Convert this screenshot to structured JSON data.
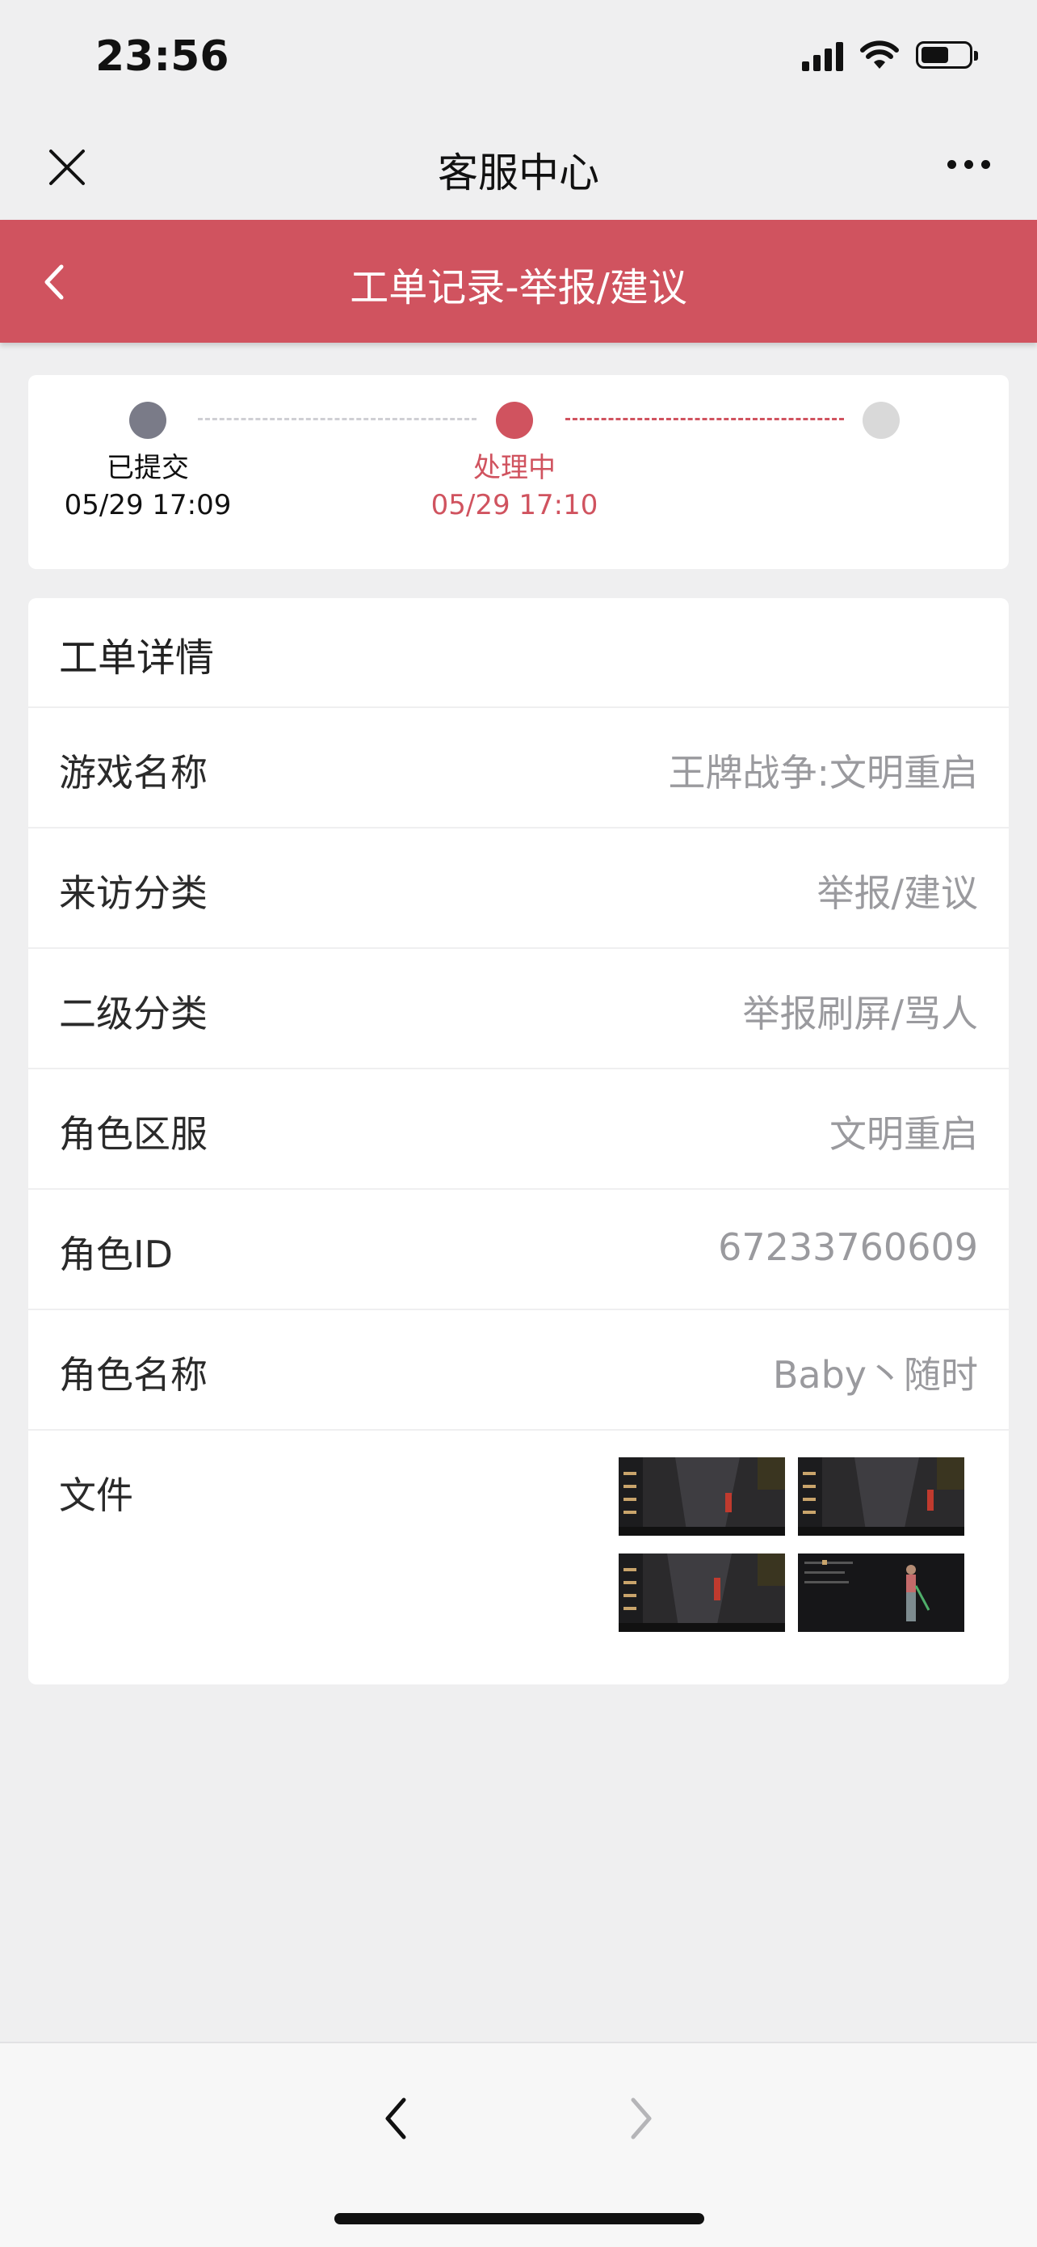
{
  "status_bar": {
    "time": "23:56"
  },
  "nav_bar": {
    "title": "客服中心"
  },
  "header": {
    "title": "工单记录-举报/建议"
  },
  "progress": {
    "steps": [
      {
        "label": "已提交",
        "time": "05/29 17:09",
        "state": "done"
      },
      {
        "label": "处理中",
        "time": "05/29 17:10",
        "state": "active"
      },
      {
        "label": "",
        "time": "",
        "state": "pending"
      }
    ]
  },
  "details": {
    "title": "工单详情",
    "rows": [
      {
        "label": "游戏名称",
        "value": "王牌战争:文明重启"
      },
      {
        "label": "来访分类",
        "value": "举报/建议"
      },
      {
        "label": "二级分类",
        "value": "举报刷屏/骂人"
      },
      {
        "label": "角色区服",
        "value": "文明重启"
      },
      {
        "label": "角色ID",
        "value": "67233760609"
      },
      {
        "label": "角色名称",
        "value": "Baby丶随时"
      }
    ],
    "files_label": "文件"
  },
  "colors": {
    "accent": "#d0535f",
    "background": "#efeff0",
    "done_dot": "#7a7b88",
    "pending_dot": "#d9d9d9"
  }
}
